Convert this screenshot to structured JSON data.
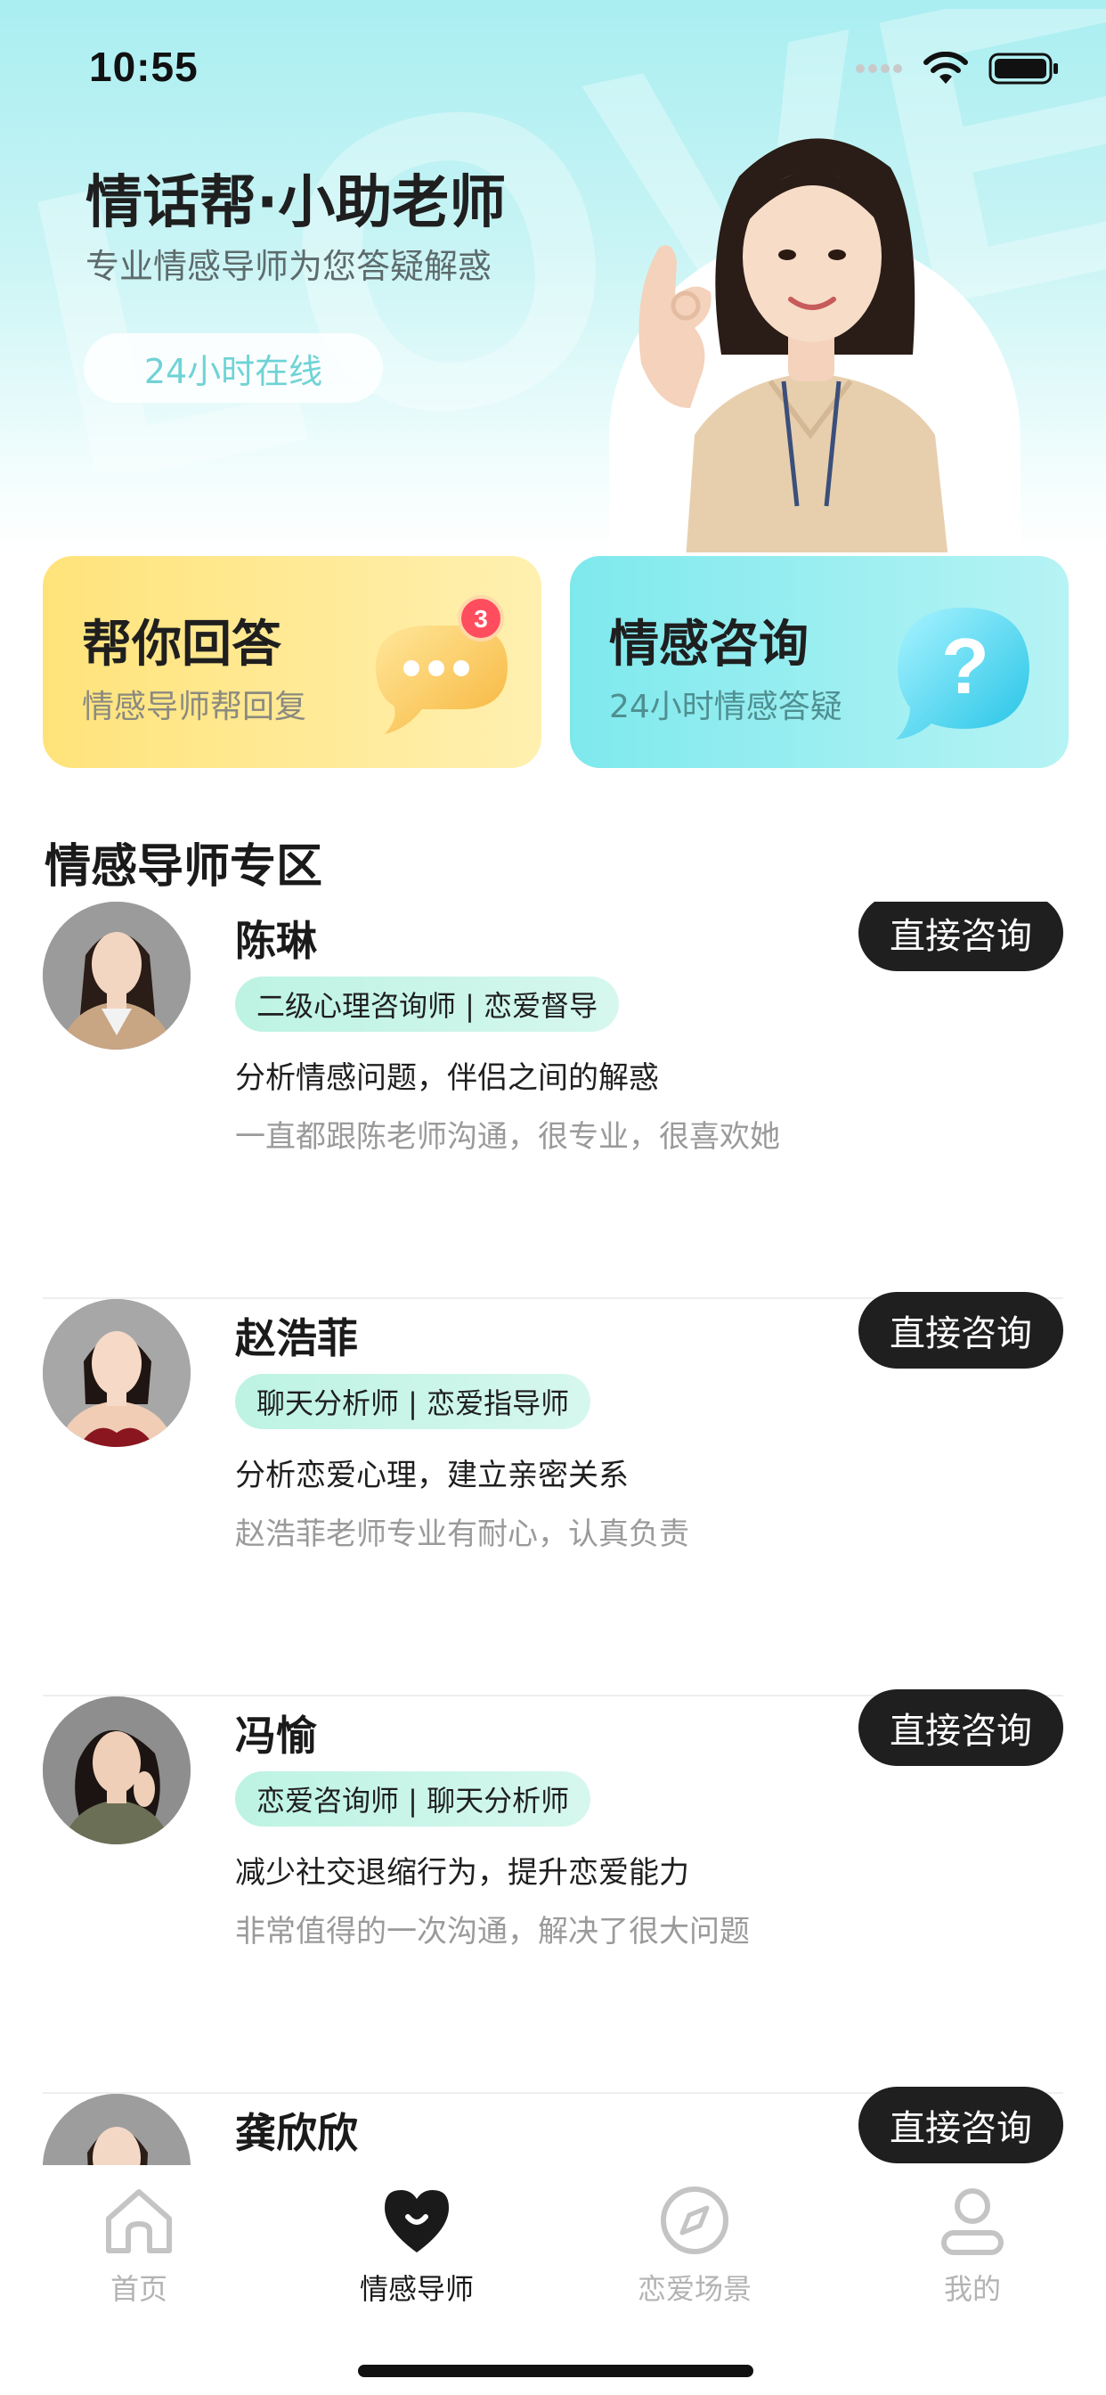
{
  "status_bar": {
    "time": "10:55"
  },
  "hero": {
    "watermark": "LOVE",
    "title": "情话帮·小助老师",
    "subtitle": "专业情感导师为您答疑解惑",
    "online_badge": "24小时在线"
  },
  "cards": [
    {
      "title": "帮你回答",
      "subtitle": "情感导师帮回复",
      "badge_count": "3",
      "icon": "chat-bubble-icon"
    },
    {
      "title": "情感咨询",
      "subtitle": "24小时情感答疑",
      "icon": "question-bubble-icon"
    }
  ],
  "section": {
    "title": "情感导师专区"
  },
  "consult_label": "直接咨询",
  "tutors": [
    {
      "name": "陈琳",
      "tag": "二级心理咨询师 | 恋爱督导",
      "desc": "分析情感问题，伴侣之间的解惑",
      "review": "一直都跟陈老师沟通，很专业，很喜欢她"
    },
    {
      "name": "赵浩菲",
      "tag": "聊天分析师 | 恋爱指导师",
      "desc": "分析恋爱心理，建立亲密关系",
      "review": "赵浩菲老师专业有耐心，认真负责"
    },
    {
      "name": "冯愉",
      "tag": "恋爱咨询师 | 聊天分析师",
      "desc": "减少社交退缩行为，提升恋爱能力",
      "review": "非常值得的一次沟通，解决了很大问题"
    },
    {
      "name": "龚欣欣",
      "tag": "",
      "desc": "",
      "review": ""
    }
  ],
  "tabbar": {
    "items": [
      {
        "label": "首页",
        "icon": "home-icon",
        "active": false
      },
      {
        "label": "情感导师",
        "icon": "heart-smile-icon",
        "active": true
      },
      {
        "label": "恋爱场景",
        "icon": "compass-icon",
        "active": false
      },
      {
        "label": "我的",
        "icon": "user-icon",
        "active": false
      }
    ]
  },
  "colors": {
    "accent_cyan": "#7ee9ed",
    "accent_yellow": "#ffe37a",
    "tag_green": "#bdf3e3",
    "dark_button": "#1f1f1f",
    "badge_red": "#ff4d5e"
  }
}
